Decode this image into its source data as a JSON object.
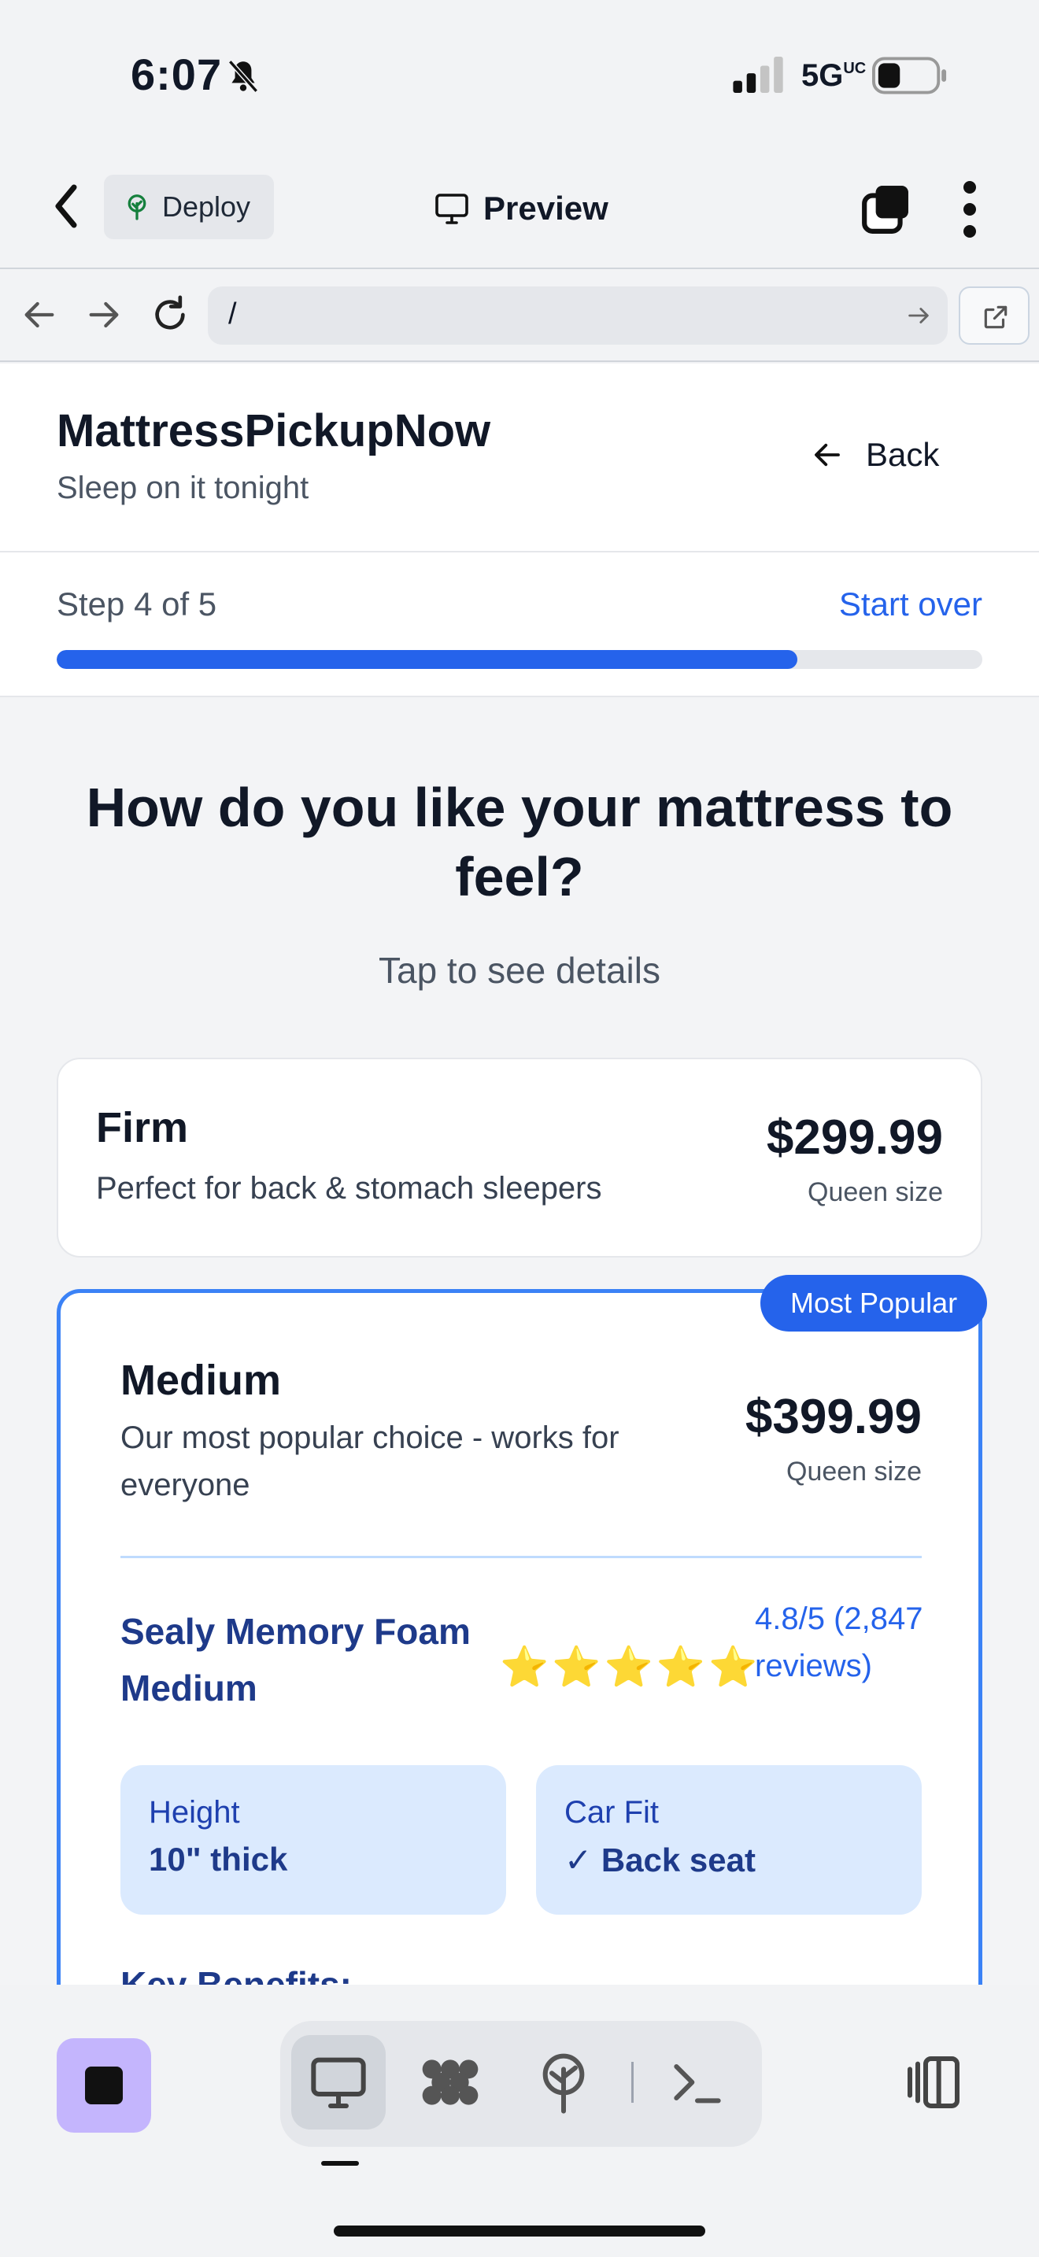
{
  "status_bar": {
    "time": "6:07",
    "network": "5G",
    "network_suffix": "UC"
  },
  "app_toolbar": {
    "deploy_label": "Deploy",
    "preview_label": "Preview"
  },
  "browser": {
    "url": "/"
  },
  "site": {
    "brand": "MattressPickupNow",
    "tagline": "Sleep on it tonight",
    "back_label": "Back"
  },
  "progress": {
    "step_label": "Step 4 of 5",
    "start_over_label": "Start over",
    "fraction": 0.8
  },
  "question": {
    "title": "How do you like your mattress to feel?",
    "hint": "Tap to see details"
  },
  "options": [
    {
      "name": "Firm",
      "description": "Perfect for back & stomach sleepers",
      "price": "$299.99",
      "size": "Queen size"
    },
    {
      "name": "Medium",
      "description": "Our most popular choice - works for everyone",
      "price": "$399.99",
      "size": "Queen size",
      "badge": "Most Popular",
      "product_name": "Sealy Memory Foam Medium",
      "stars": "⭐⭐⭐⭐⭐",
      "rating": "4.8/5 (2,847 reviews)",
      "specs": [
        {
          "label": "Height",
          "value": "10\" thick"
        },
        {
          "label": "Car Fit",
          "value": "✓ Back seat"
        }
      ],
      "benefits_title": "Key Benefits:"
    }
  ],
  "colors": {
    "accent": "#2563eb",
    "selected_border": "#3b82f6",
    "spec_bg": "#dbeafe",
    "stop_button": "#c4b5fd"
  },
  "icons": {
    "back": "chevron-left-icon",
    "deploy": "tree-icon",
    "preview": "monitor-icon",
    "tabs": "tabs-icon",
    "more": "kebab-icon",
    "bottom_tabs": [
      "monitor-icon",
      "grid-blob-icon",
      "tree-icon",
      "terminal-icon"
    ]
  }
}
